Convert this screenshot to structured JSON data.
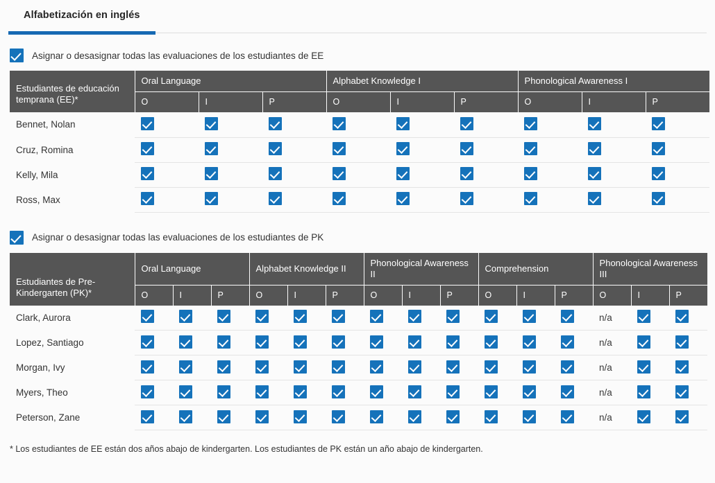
{
  "tabs": [
    {
      "label": "Alfabetización en inglés",
      "active": true
    }
  ],
  "accent_color": "#1669b3",
  "checkbox_color": "#1572ba",
  "header_color": "#555555",
  "ee_section": {
    "select_all_label": "Asignar o desasignar todas las evaluaciones de los estudiantes de EE",
    "select_all_checked": true,
    "name_header": "Estudiantes de educación temprana (EE)*",
    "groups": [
      {
        "label": "Oral Language",
        "sub": [
          "O",
          "I",
          "P"
        ]
      },
      {
        "label": "Alphabet Knowledge I",
        "sub": [
          "O",
          "I",
          "P"
        ]
      },
      {
        "label": "Phonological Awareness I",
        "sub": [
          "O",
          "I",
          "P"
        ]
      }
    ],
    "rows": [
      {
        "name": "Bennet, Nolan",
        "cells": [
          "check",
          "check",
          "check",
          "check",
          "check",
          "check",
          "check",
          "check",
          "check"
        ]
      },
      {
        "name": "Cruz, Romina",
        "cells": [
          "check",
          "check",
          "check",
          "check",
          "check",
          "check",
          "check",
          "check",
          "check"
        ]
      },
      {
        "name": "Kelly, Mila",
        "cells": [
          "check",
          "check",
          "check",
          "check",
          "check",
          "check",
          "check",
          "check",
          "check"
        ]
      },
      {
        "name": "Ross, Max",
        "cells": [
          "check",
          "check",
          "check",
          "check",
          "check",
          "check",
          "check",
          "check",
          "check"
        ]
      }
    ]
  },
  "pk_section": {
    "select_all_label": "Asignar o desasignar todas las evaluaciones de los estudiantes de PK",
    "select_all_checked": true,
    "name_header": "Estudiantes de Pre-Kindergarten (PK)*",
    "groups": [
      {
        "label": "Oral Language",
        "sub": [
          "O",
          "I",
          "P"
        ]
      },
      {
        "label": "Alphabet Knowledge II",
        "sub": [
          "O",
          "I",
          "P"
        ]
      },
      {
        "label": "Phonological Awareness II",
        "sub": [
          "O",
          "I",
          "P"
        ]
      },
      {
        "label": "Comprehension",
        "sub": [
          "O",
          "I",
          "P"
        ]
      },
      {
        "label": "Phonological Awareness III",
        "sub": [
          "O",
          "I",
          "P"
        ]
      }
    ],
    "na_text": "n/a",
    "rows": [
      {
        "name": "Clark, Aurora",
        "cells": [
          "check",
          "check",
          "check",
          "check",
          "check",
          "check",
          "check",
          "check",
          "check",
          "check",
          "check",
          "check",
          "na",
          "check",
          "check"
        ]
      },
      {
        "name": "Lopez, Santiago",
        "cells": [
          "check",
          "check",
          "check",
          "check",
          "check",
          "check",
          "check",
          "check",
          "check",
          "check",
          "check",
          "check",
          "na",
          "check",
          "check"
        ]
      },
      {
        "name": "Morgan, Ivy",
        "cells": [
          "check",
          "check",
          "check",
          "check",
          "check",
          "check",
          "check",
          "check",
          "check",
          "check",
          "check",
          "check",
          "na",
          "check",
          "check"
        ]
      },
      {
        "name": "Myers, Theo",
        "cells": [
          "check",
          "check",
          "check",
          "check",
          "check",
          "check",
          "check",
          "check",
          "check",
          "check",
          "check",
          "check",
          "na",
          "check",
          "check"
        ]
      },
      {
        "name": "Peterson, Zane",
        "cells": [
          "check",
          "check",
          "check",
          "check",
          "check",
          "check",
          "check",
          "check",
          "check",
          "check",
          "check",
          "check",
          "na",
          "check",
          "check"
        ]
      }
    ]
  },
  "footnote": "* Los estudiantes de EE están dos años abajo de kindergarten. Los estudiantes de PK están un año abajo de kindergarten."
}
